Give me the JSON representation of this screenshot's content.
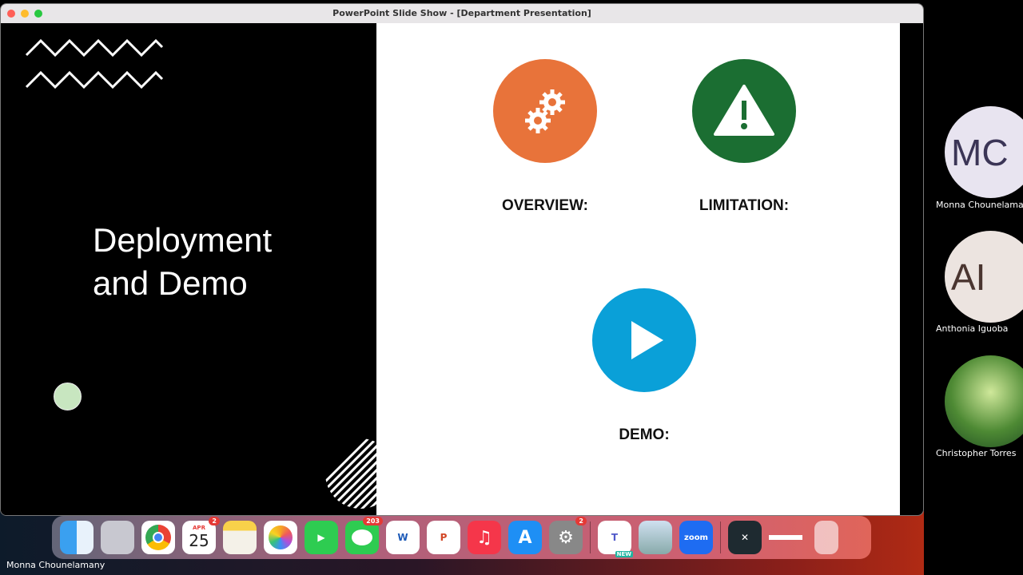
{
  "window": {
    "title": "PowerPoint Slide Show - [Department Presentation]"
  },
  "slide": {
    "title_line1": "Deployment",
    "title_line2": "and Demo",
    "items": [
      {
        "label": "OVERVIEW:",
        "icon": "gears-icon",
        "color": "#e8733a"
      },
      {
        "label": "LIMITATION:",
        "icon": "warning-icon",
        "color": "#1b6e32"
      },
      {
        "label": "DEMO:",
        "icon": "play-icon",
        "color": "#0aa0d8"
      }
    ]
  },
  "participants": [
    {
      "initials": "MC",
      "name": "Monna Chounelamany",
      "bg": "#e8e4f0",
      "fg": "#3b3556"
    },
    {
      "initials": "AI",
      "name": "Anthonia Iguoba",
      "bg": "#ece4e0",
      "fg": "#4a3530"
    },
    {
      "initials": "",
      "name": "Christopher Torres"
    }
  ],
  "speaker_caption": "Monna Chounelamany",
  "dock": {
    "calendar_month": "APR",
    "calendar_day": "25",
    "calendar_badge": "2",
    "messages_badge": "203",
    "settings_badge": "2",
    "word_letter": "W",
    "powerpoint_letter": "P",
    "teams_badge": "NEW",
    "zoom_label": "zoom"
  }
}
